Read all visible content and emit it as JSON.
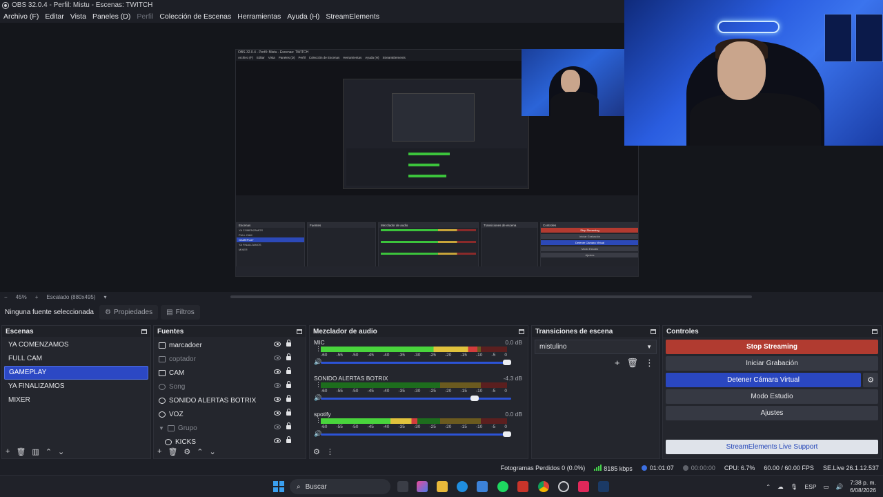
{
  "window": {
    "title": "OBS 32.0.4 - Perfil: Mistu - Escenas: TWITCH"
  },
  "menu": [
    "Archivo (F)",
    "Editar",
    "Vista",
    "Paneles (D)",
    "Perfil",
    "Colección de Escenas",
    "Herramientas",
    "Ayuda (H)",
    "StreamElements"
  ],
  "zoom": {
    "minus": "−",
    "level": "45%",
    "plus": "+",
    "mode": "Escalado (880x495)",
    "arrow": "▾"
  },
  "props": {
    "no_source": "Ninguna fuente seleccionada",
    "properties": "Propiedades",
    "filters": "Filtros"
  },
  "scenes": {
    "title": "Escenas",
    "items": [
      "YA COMENZAMOS",
      "FULL CAM",
      "GAMEPLAY",
      "YA FINALIZAMOS",
      "MIXER"
    ],
    "selected": "GAMEPLAY"
  },
  "sources": {
    "title": "Fuentes",
    "items": [
      {
        "name": "marcadoer",
        "visible": true,
        "locked": true
      },
      {
        "name": "coptador",
        "visible": false,
        "locked": true
      },
      {
        "name": "CAM",
        "visible": true,
        "locked": true
      },
      {
        "name": "Song",
        "visible": false,
        "locked": true
      },
      {
        "name": "SONIDO ALERTAS BOTRIX",
        "visible": true,
        "locked": true
      },
      {
        "name": "VOZ",
        "visible": true,
        "locked": true
      },
      {
        "name": "Grupo",
        "visible": false,
        "locked": true
      },
      {
        "name": "KICKS",
        "visible": true,
        "locked": true
      }
    ]
  },
  "mixer": {
    "title": "Mezclador de audio",
    "ticks": [
      "-60",
      "-55",
      "-50",
      "-45",
      "-40",
      "-35",
      "-30",
      "-25",
      "-20",
      "-15",
      "-10",
      "-5",
      "0"
    ],
    "channels": [
      {
        "name": "MIC",
        "db": "0.0 dB",
        "level": 0.84,
        "volume": 1.0
      },
      {
        "name": "SONIDO ALERTAS BOTRIX",
        "db": "-4.3 dB",
        "level": 0.0,
        "volume": 0.83
      },
      {
        "name": "spotify",
        "db": "0.0 dB",
        "level": 0.52,
        "volume": 1.0
      }
    ]
  },
  "transitions": {
    "title": "Transiciones de escena",
    "selected": "mistulino"
  },
  "controls": {
    "title": "Controles",
    "stop_streaming": "Stop Streaming",
    "start_recording": "Iniciar Grabación",
    "stop_virtual_cam": "Detener Cámara Virtual",
    "studio_mode": "Modo Estudio",
    "settings": "Ajustes",
    "se_support": "StreamElements Live Support"
  },
  "status": {
    "dropped": "Fotogramas Perdidos 0 (0.0%)",
    "bitrate": "8185 kbps",
    "live_time": "01:01:07",
    "rec_time": "00:00:00",
    "cpu": "CPU: 6.7%",
    "fps": "60.00 / 60.00 FPS",
    "se_version": "SE.Live 26.1.12.537"
  },
  "taskbar": {
    "search": "Buscar",
    "lang": "ESP",
    "time": "7:38 p. m.",
    "date": "6/08/2026"
  },
  "inner": {
    "title": "OBS 32.0.4 - Perfil: Mistu - Escenas: TWITCH",
    "menu": [
      "Archivo (F)",
      "Editar",
      "Vista",
      "Paneles (D)",
      "Perfil",
      "Colección de Escenas",
      "Herramientas",
      "Ayuda (H)",
      "StreamElements"
    ],
    "scenes": [
      "YA COMENZAMOS",
      "FULL CAM",
      "GAMEPLAY",
      "YA FINALIZAMOS",
      "MIXER"
    ],
    "stop": "Stop Streaming",
    "record": "Iniciar Grabación",
    "vcam": "Detener Cámara Virtual",
    "studio": "Modo Estudio",
    "settings": "Ajustes"
  },
  "colors": {
    "accent": "#2c48c4",
    "stop": "#b13b30",
    "bg": "#1d1f26",
    "panel": "#24262d"
  }
}
